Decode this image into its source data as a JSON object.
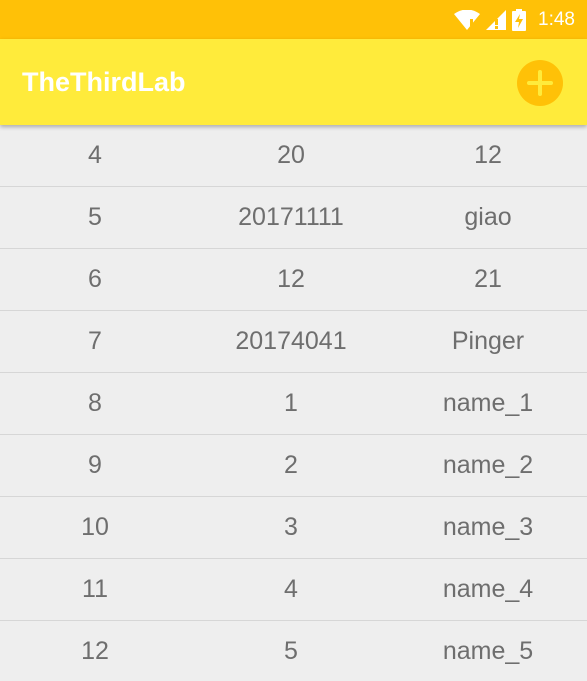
{
  "status_bar": {
    "time": "1:48",
    "icons": [
      "wifi-icon",
      "signal-icon",
      "battery-charging-icon"
    ],
    "color": "#ffc107"
  },
  "app_bar": {
    "title": "TheThirdLab",
    "action_icon": "add-icon",
    "color": "#ffeb3b",
    "accent": "#ffc107"
  },
  "rows": [
    {
      "id": "4",
      "number": "20",
      "name": "12"
    },
    {
      "id": "5",
      "number": "20171111",
      "name": "giao"
    },
    {
      "id": "6",
      "number": "12",
      "name": "21"
    },
    {
      "id": "7",
      "number": "20174041",
      "name": "Pinger"
    },
    {
      "id": "8",
      "number": "1",
      "name": "name_1"
    },
    {
      "id": "9",
      "number": "2",
      "name": "name_2"
    },
    {
      "id": "10",
      "number": "3",
      "name": "name_3"
    },
    {
      "id": "11",
      "number": "4",
      "name": "name_4"
    },
    {
      "id": "12",
      "number": "5",
      "name": "name_5"
    }
  ]
}
